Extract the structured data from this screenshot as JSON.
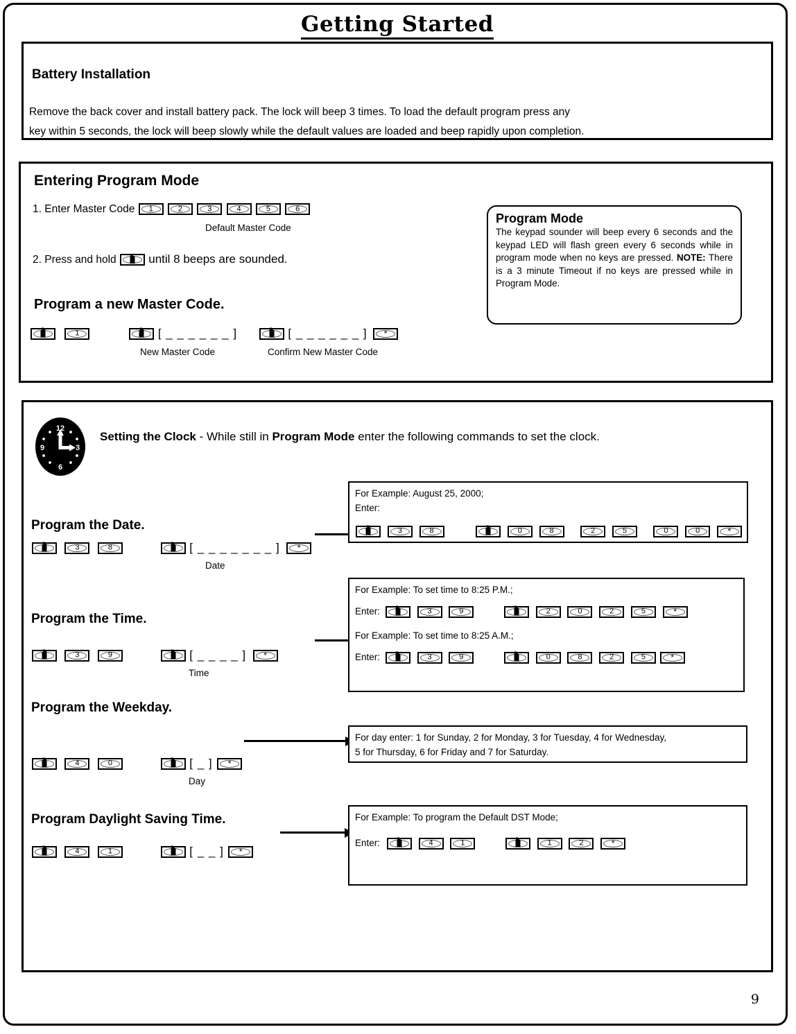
{
  "page": {
    "title": "Getting Started",
    "page_number": "9"
  },
  "battery": {
    "heading": "Battery Installation",
    "line1": "Remove the back cover and install battery pack. The lock will beep 3 times.  To load the default program press any",
    "line2": "key within 5 seconds, the lock will beep slowly while the default values are loaded and beep rapidly upon completion."
  },
  "program_mode_section": {
    "heading": "Entering Program Mode",
    "step1_prefix": "1. Enter Master Code",
    "step1_keys": [
      "1",
      "2",
      "3",
      "4",
      "5",
      "6"
    ],
    "step1_caption": "Default Master Code",
    "step2_prefix": "2. Press and hold",
    "step2_suffix": "until 8 beeps are sounded.",
    "new_master_heading": "Program a new Master Code.",
    "new_master_keys": [
      "lock",
      "1"
    ],
    "new_master_second_key": "lock",
    "new_master_slot": "[ _ _ _ _ _ _ ]",
    "new_master_caption": "New Master Code",
    "confirm_key": "lock",
    "confirm_slot": "[ _ _ _ _ _ _ ]",
    "confirm_star": "*",
    "confirm_caption": "Confirm New Master Code"
  },
  "program_mode_callout": {
    "title": "Program Mode",
    "body_pre_note": "The keypad sounder will beep every 6 seconds and the keypad LED will flash green every 6 seconds while in program mode when no keys are pressed. ",
    "note_label": "NOTE:",
    "body_post_note": " There is a 3 minute Timeout if no keys are pressed while in Program Mode."
  },
  "clock_section": {
    "icon_name": "clock-icon",
    "clock_numerals": [
      "12",
      "3",
      "6",
      "9"
    ],
    "title_bold": "Setting the Clock",
    "title_mid": " - While still in ",
    "title_bold2": "Program Mode",
    "title_end": " enter the following commands to set the clock.",
    "date": {
      "heading": "Program the Date.",
      "cmd_keys": [
        "lock",
        "3",
        "8"
      ],
      "entry_key": "lock",
      "slot": "[ _ _ _ _ _ _ _ ]",
      "star": "*",
      "caption": "Date",
      "example_line1": "For Example: August 25, 2000;",
      "example_line2": "Enter:",
      "example_keys_group1": [
        "lock",
        "3",
        "8"
      ],
      "example_keys_group2": [
        "lock",
        "0",
        "8"
      ],
      "example_keys_group3": [
        "2",
        "5"
      ],
      "example_keys_group4": [
        "0",
        "0"
      ],
      "example_star": "*"
    },
    "time": {
      "heading": "Program the Time.",
      "cmd_keys": [
        "lock",
        "3",
        "9"
      ],
      "entry_key": "lock",
      "slot": "[ _ _ _ _ ]",
      "star": "*",
      "caption": "Time",
      "example1_text": "For Example:  To set time to 8:25 P.M.;",
      "example1_enter": "Enter:",
      "example1_keys_group1": [
        "lock",
        "3",
        "9"
      ],
      "example1_keys_group2": [
        "lock",
        "2",
        "0",
        "2",
        "5"
      ],
      "example1_star": "*",
      "example2_text": "For Example:  To set time to 8:25 A.M.;",
      "example2_enter": "Enter:",
      "example2_keys_group1": [
        "lock",
        "3",
        "9"
      ],
      "example2_keys_group2": [
        "lock",
        "0",
        "8",
        "2",
        "5"
      ],
      "example2_star": "*"
    },
    "weekday": {
      "heading": "Program the Weekday.",
      "cmd_keys": [
        "lock",
        "4",
        "0"
      ],
      "entry_key": "lock",
      "slot": "[ _ ]",
      "star": "*",
      "caption": "Day",
      "example_line1": "For day enter: 1 for Sunday, 2 for Monday, 3 for Tuesday, 4 for Wednesday,",
      "example_line2": "5 for Thursday, 6 for Friday and  7 for Saturday."
    },
    "dst": {
      "heading": "Program Daylight Saving Time.",
      "cmd_keys": [
        "lock",
        "4",
        "1"
      ],
      "entry_key": "lock",
      "slot": "[ _ _ ]",
      "star": "*",
      "example_line1": "For Example: To program the Default DST Mode;",
      "example_enter": "Enter:",
      "example_keys_group1": [
        "lock",
        "4",
        "1"
      ],
      "example_keys_group2": [
        "lock",
        "1",
        "2"
      ],
      "example_star": "*"
    }
  }
}
